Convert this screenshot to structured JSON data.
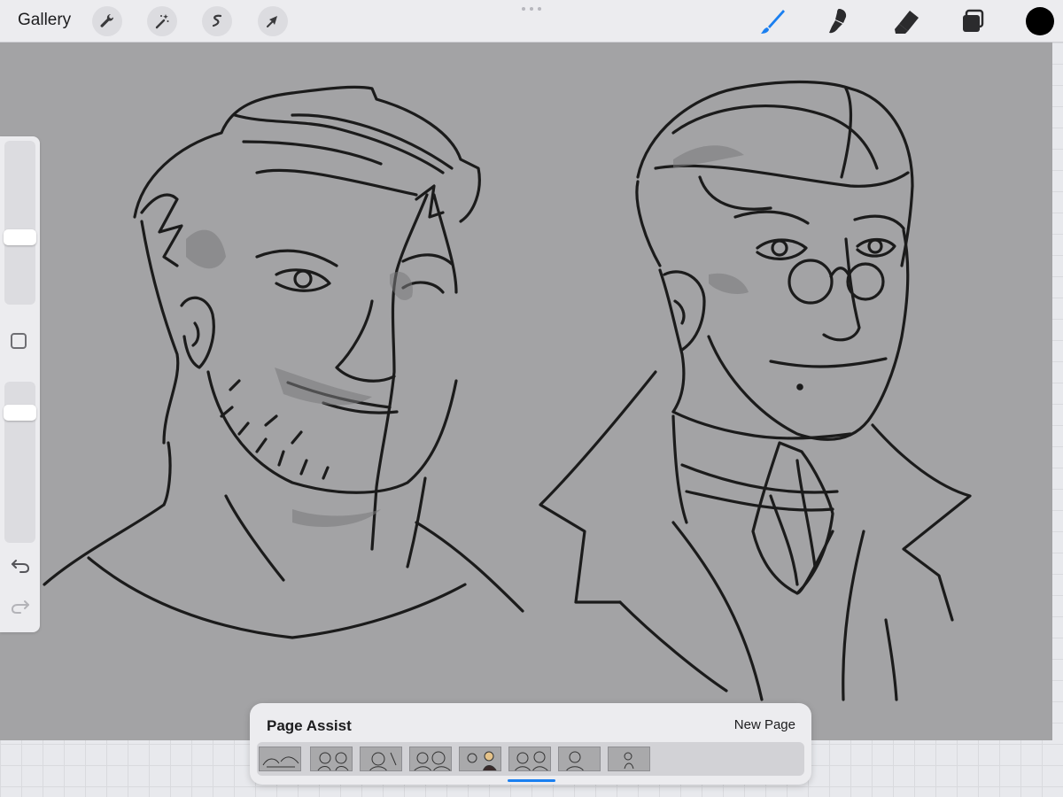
{
  "topbar": {
    "gallery_label": "Gallery",
    "left_tools": [
      {
        "icon": "wrench-icon",
        "label": "actions"
      },
      {
        "icon": "magic-wand-icon",
        "label": "adjustments"
      },
      {
        "icon": "selection-icon",
        "label": "selection"
      },
      {
        "icon": "arrow-icon",
        "label": "transform"
      }
    ],
    "right_tools": [
      {
        "icon": "brush-icon",
        "active": true
      },
      {
        "icon": "smudge-icon",
        "active": false
      },
      {
        "icon": "eraser-icon",
        "active": false
      },
      {
        "icon": "layers-icon",
        "active": false
      }
    ],
    "current_color": "#000000",
    "accent_color": "#1a7ff0"
  },
  "sidebar": {
    "brush_size_level": 0.4,
    "opacity_level": 0.84,
    "icons": [
      "modify-square-icon",
      "undo-icon",
      "redo-icon"
    ]
  },
  "page_assist": {
    "title": "Page Assist",
    "new_page_label": "New Page",
    "page_count": 8,
    "selected_page_index": 5
  }
}
